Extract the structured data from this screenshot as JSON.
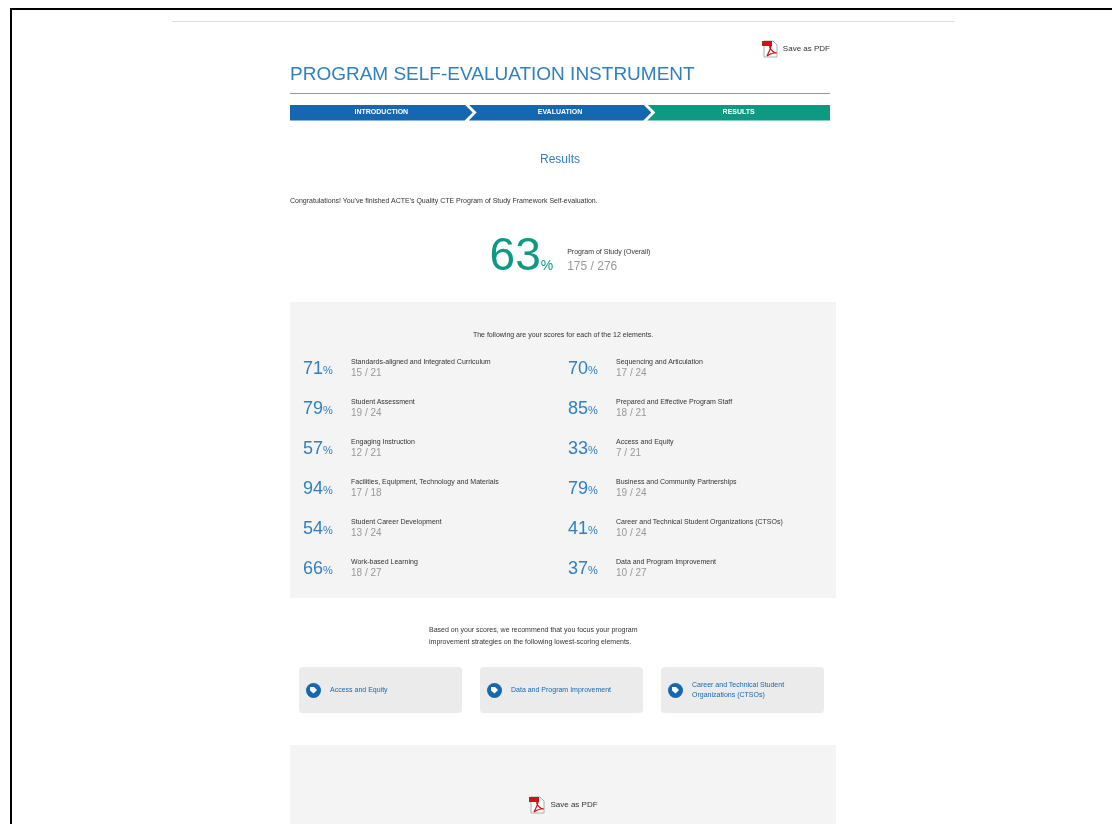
{
  "save_pdf_top": "Save as PDF",
  "title": "PROGRAM SELF-EVALUATION INSTRUMENT",
  "steps": [
    {
      "label": "INTRODUCTION",
      "selected": false
    },
    {
      "label": "EVALUATION",
      "selected": false
    },
    {
      "label": "RESULTS",
      "selected": true
    }
  ],
  "heading": "Results",
  "congrats": "Congratulations! You've finished ACTE's Quality CTE Program of Study Framework Self-evaluation.",
  "overall": {
    "percent": "63",
    "sign": "%",
    "label": "Program of Study (Overall)",
    "score": "175 / 276"
  },
  "scores_intro": "The following are your scores for each of the 12 elements.",
  "scores": [
    {
      "percent": "71",
      "sign": "%",
      "name": "Standards-aligned and Integrated Curriculum",
      "score": "15 / 21"
    },
    {
      "percent": "70",
      "sign": "%",
      "name": "Sequencing and Articulation",
      "score": "17 / 24"
    },
    {
      "percent": "79",
      "sign": "%",
      "name": "Student Assessment",
      "score": "19 / 24"
    },
    {
      "percent": "85",
      "sign": "%",
      "name": "Prepared and Effective Program Staff",
      "score": "18 / 21"
    },
    {
      "percent": "57",
      "sign": "%",
      "name": "Engaging Instruction",
      "score": "12 / 21"
    },
    {
      "percent": "33",
      "sign": "%",
      "name": "Access and Equity",
      "score": "7 / 21"
    },
    {
      "percent": "94",
      "sign": "%",
      "name": "Facilities, Equipment, Technology and Materials",
      "score": "17 / 18"
    },
    {
      "percent": "79",
      "sign": "%",
      "name": "Business and Community Partnerships",
      "score": "19 / 24"
    },
    {
      "percent": "54",
      "sign": "%",
      "name": "Student Career Development",
      "score": "13 / 24"
    },
    {
      "percent": "41",
      "sign": "%",
      "name": "Career and Technical Student Organizations (CTSOs)",
      "score": "10 / 24"
    },
    {
      "percent": "66",
      "sign": "%",
      "name": "Work-based Learning",
      "score": "18 / 27"
    },
    {
      "percent": "37",
      "sign": "%",
      "name": "Data and Program Improvement",
      "score": "10 / 27"
    }
  ],
  "recommend": "Based on your scores, we recommend that you focus your program improvement strategies on the following lowest-scoring elements.",
  "focus": [
    "Access and Equity",
    "Data and Program Improvement",
    "Career and Technical Student Organizations (CTSOs)"
  ],
  "save_pdf_bottom": "Save as PDF"
}
